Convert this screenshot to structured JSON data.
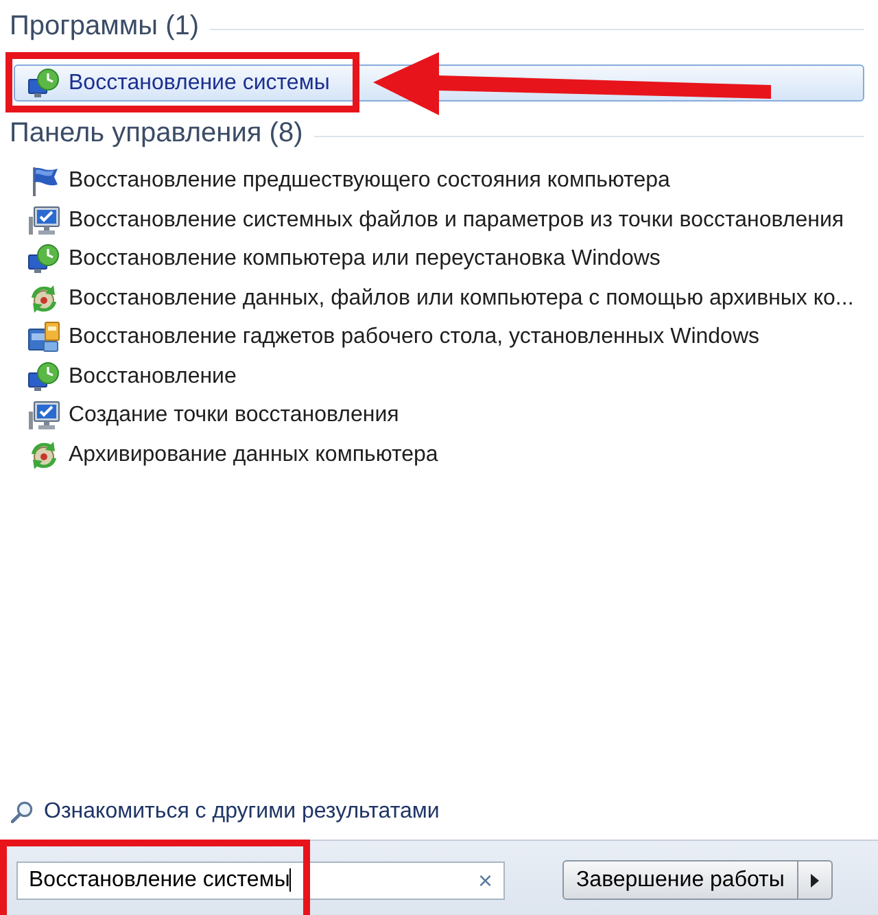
{
  "programs": {
    "title": "Программы (1)",
    "items": [
      {
        "label": "Восстановление системы",
        "kind": "recovery",
        "selected": true,
        "highlighted": true,
        "pointed_at": true
      }
    ]
  },
  "control_panel": {
    "title": "Панель управления (8)",
    "items": [
      {
        "label": "Восстановление предшествующего состояния компьютера",
        "kind": "flag",
        "selected": false
      },
      {
        "label": "Восстановление системных файлов и параметров из точки восстановления",
        "kind": "checkpoint",
        "selected": false
      },
      {
        "label": "Восстановление компьютера или переустановка Windows",
        "kind": "recovery",
        "selected": false
      },
      {
        "label": "Восстановление данных, файлов или компьютера с помощью архивных ко...",
        "kind": "backup",
        "selected": false
      },
      {
        "label": "Восстановление гаджетов рабочего стола, установленных Windows",
        "kind": "gadgets",
        "selected": false
      },
      {
        "label": "Восстановление",
        "kind": "recovery",
        "selected": false
      },
      {
        "label": "Создание точки восстановления",
        "kind": "checkpoint",
        "selected": false
      },
      {
        "label": "Архивирование данных компьютера",
        "kind": "backup",
        "selected": false
      }
    ]
  },
  "more_results": {
    "label": "Ознакомиться с другими результатами"
  },
  "search": {
    "value": "Восстановление системы",
    "focused": true,
    "clear_button": "×",
    "highlighted": true
  },
  "shutdown": {
    "label": "Завершение работы"
  }
}
